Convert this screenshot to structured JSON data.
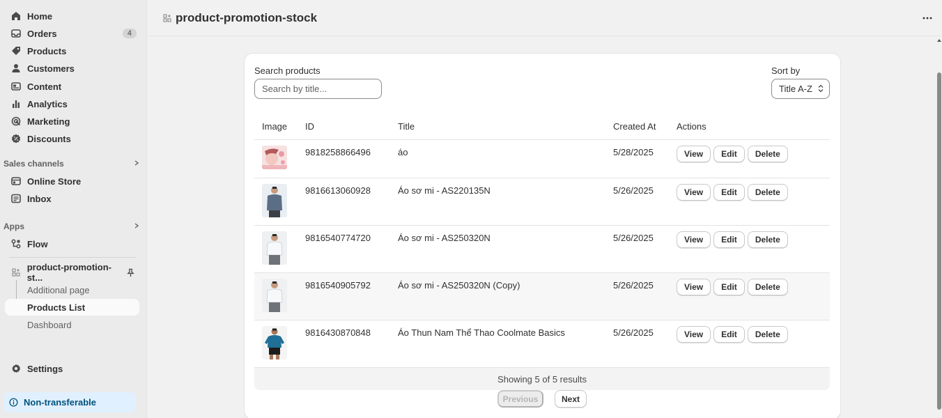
{
  "sidebar": {
    "nav": [
      {
        "label": "Home",
        "icon": "home-icon"
      },
      {
        "label": "Orders",
        "icon": "inbox-tray-icon",
        "badge": "4"
      },
      {
        "label": "Products",
        "icon": "tag-icon"
      },
      {
        "label": "Customers",
        "icon": "person-icon"
      },
      {
        "label": "Content",
        "icon": "content-icon"
      },
      {
        "label": "Analytics",
        "icon": "bar-chart-icon"
      },
      {
        "label": "Marketing",
        "icon": "target-icon"
      },
      {
        "label": "Discounts",
        "icon": "discount-icon"
      }
    ],
    "sales_channels": {
      "header": "Sales channels",
      "items": [
        {
          "label": "Online Store",
          "icon": "storefront-icon"
        },
        {
          "label": "Inbox",
          "icon": "inbox-icon"
        }
      ]
    },
    "apps": {
      "header": "Apps",
      "items": [
        {
          "label": "Flow",
          "icon": "flow-icon"
        }
      ]
    },
    "app": {
      "label": "product-promotion-st...",
      "icon": "app-grid-icon",
      "pin_icon": "pin-icon",
      "subitems": [
        {
          "label": "Additional page"
        },
        {
          "label": "Products List",
          "active": true
        },
        {
          "label": "Dashboard"
        }
      ]
    },
    "settings": {
      "label": "Settings",
      "icon": "gear-icon"
    },
    "non_transferable": {
      "label": "Non-transferable",
      "icon": "info-icon"
    }
  },
  "header": {
    "title": "product-promotion-stock",
    "icon": "app-grid-icon",
    "more_icon": "ellipsis-icon"
  },
  "search": {
    "label": "Search products",
    "placeholder": "Search by title...",
    "value": ""
  },
  "sort": {
    "label": "Sort by",
    "value": "Title A-Z"
  },
  "table": {
    "columns": [
      "Image",
      "ID",
      "Title",
      "Created At",
      "Actions"
    ],
    "actions": {
      "view": "View",
      "edit": "Edit",
      "delete": "Delete"
    },
    "rows": [
      {
        "id": "9818258866496",
        "title": "áo",
        "created_at": "5/28/2025"
      },
      {
        "id": "9816613060928",
        "title": "Áo sơ mi - AS220135N",
        "created_at": "5/26/2025"
      },
      {
        "id": "9816540774720",
        "title": "Áo sơ mi - AS250320N",
        "created_at": "5/26/2025"
      },
      {
        "id": "9816540905792",
        "title": "Áo sơ mi - AS250320N (Copy)",
        "created_at": "5/26/2025"
      },
      {
        "id": "9816430870848",
        "title": "Áo Thun Nam Thể Thao Coolmate Basics",
        "created_at": "5/26/2025"
      }
    ]
  },
  "pagination": {
    "summary": "Showing 5 of 5 results",
    "previous": "Previous",
    "next": "Next"
  },
  "colors": {
    "sidebar_bg": "#ebebeb",
    "page_bg": "#f1f1f1",
    "card_bg": "#ffffff",
    "info_banner_bg": "#e0f0ff",
    "info_banner_text": "#00527c"
  }
}
